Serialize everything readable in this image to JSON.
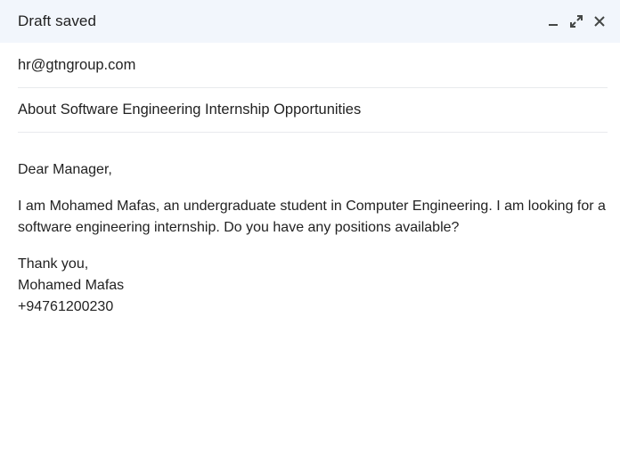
{
  "header": {
    "title": "Draft saved",
    "icons": [
      "minimize-icon",
      "expand-icon",
      "close-icon"
    ]
  },
  "recipient": "hr@gtngroup.com",
  "subject": "About Software Engineering Internship Opportunities",
  "message": {
    "greeting": "Dear Manager,",
    "paragraph": "I am Mohamed Mafas, an undergraduate student in Computer Engineering. I am looking for a software engineering internship. Do you have any positions available?",
    "closing": "Thank you,",
    "signature_name": "Mohamed Mafas",
    "signature_phone": "+94761200230"
  },
  "colors": {
    "header_bg": "#f2f6fc",
    "text": "#222222",
    "divider": "#e8eaed"
  }
}
